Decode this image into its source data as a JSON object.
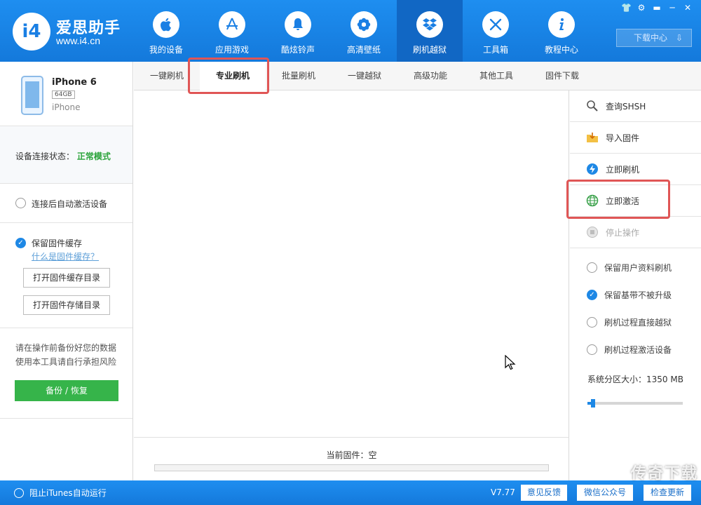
{
  "app": {
    "brand": "爱思助手",
    "url": "www.i4.cn",
    "logo_text": "i4"
  },
  "nav": [
    {
      "label": "我的设备",
      "icon": "apple-icon"
    },
    {
      "label": "应用游戏",
      "icon": "app-store-icon"
    },
    {
      "label": "酷炫铃声",
      "icon": "bell-icon"
    },
    {
      "label": "高清壁纸",
      "icon": "flower-icon"
    },
    {
      "label": "刷机越狱",
      "icon": "dropbox-icon"
    },
    {
      "label": "工具箱",
      "icon": "tools-icon"
    },
    {
      "label": "教程中心",
      "icon": "info-icon"
    }
  ],
  "window_controls": [
    "👕",
    "⚙",
    "▬",
    "─",
    "✕"
  ],
  "download_center": "下载中心",
  "device": {
    "name": "iPhone 6",
    "capacity": "64GB",
    "type": "iPhone"
  },
  "status": {
    "label": "设备连接状态：",
    "value": "正常模式"
  },
  "left": {
    "auto_activate": "连接后自动激活设备",
    "keep_cache": "保留固件缓存",
    "what_cache": "什么是固件缓存？",
    "open_cache_dir": "打开固件缓存目录",
    "open_storage_dir": "打开固件存储目录",
    "warning_line1": "请在操作前备份好您的数据",
    "warning_line2": "使用本工具请自行承担风险",
    "backup_btn": "备份 / 恢复"
  },
  "tabs": [
    "一键刷机",
    "专业刷机",
    "批量刷机",
    "一键越狱",
    "高级功能",
    "其他工具",
    "固件下载"
  ],
  "main": {
    "current_firmware": "当前固件：空",
    "progress": 0
  },
  "right": {
    "actions": [
      {
        "label": "查询SHSH",
        "icon": "search-shsh-icon"
      },
      {
        "label": "导入固件",
        "icon": "import-folder-icon"
      },
      {
        "label": "立即刷机",
        "icon": "flash-icon"
      },
      {
        "label": "立即激活",
        "icon": "globe-icon"
      },
      {
        "label": "停止操作",
        "icon": "stop-icon"
      }
    ],
    "options": [
      {
        "label": "保留用户资料刷机",
        "checked": false
      },
      {
        "label": "保留基带不被升级",
        "checked": true
      },
      {
        "label": "刷机过程直接越狱",
        "checked": false
      },
      {
        "label": "刷机过程激活设备",
        "checked": false
      }
    ],
    "partition_label": "系统分区大小：1350 MB",
    "partition_level": 0.06
  },
  "footer": {
    "itunes": "阻止iTunes自动运行",
    "version": "V7.77",
    "feedback": "意见反馈",
    "wechat": "微信公众号",
    "update": "检查更新"
  },
  "watermark": "传奇下载",
  "colors": {
    "brand": "#1a7fe4",
    "highlight": "#e05656",
    "ok": "#2aa33a",
    "green_button": "#36b44a"
  }
}
